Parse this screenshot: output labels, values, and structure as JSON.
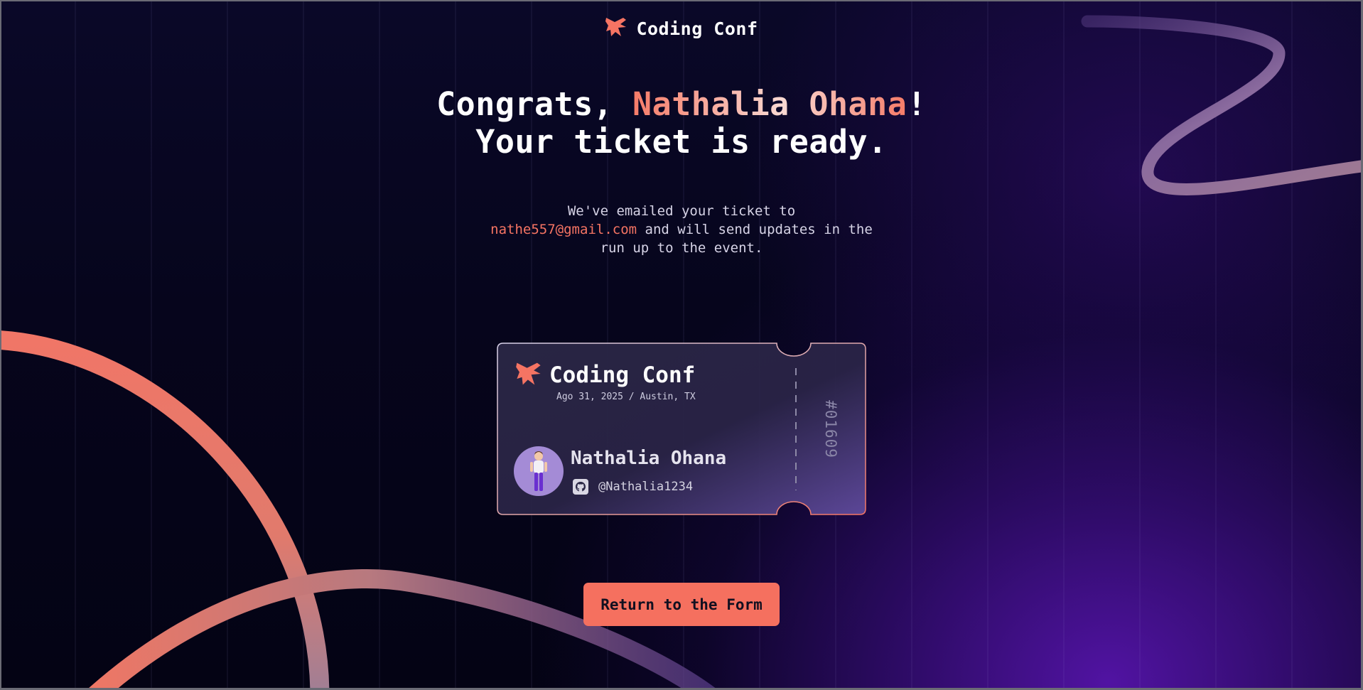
{
  "brand": {
    "name": "Coding Conf",
    "logo_icon": "coding-conf-logo-icon",
    "accent_color": "#f57463"
  },
  "headline": {
    "prefix": "Congrats, ",
    "name": "Nathalia Ohana",
    "suffix": "!",
    "line2": "Your ticket is ready."
  },
  "message": {
    "before": "We've emailed your ticket to",
    "email": "nathe557@gmail.com",
    "after": " and will send updates in the run up to the event."
  },
  "ticket": {
    "brand": "Coding Conf",
    "date_location": "Ago 31, 2025 / Austin, TX",
    "attendee_name": "Nathalia Ohana",
    "github_handle": "@Nathalia1234",
    "github_icon": "github-icon",
    "avatar_icon": "avatar",
    "number": "#01609"
  },
  "actions": {
    "return_label": "Return to the Form"
  },
  "colors": {
    "background": "#05041a",
    "purple_glow": "#5514aa",
    "button": "#f5705f",
    "button_text": "#121020"
  }
}
